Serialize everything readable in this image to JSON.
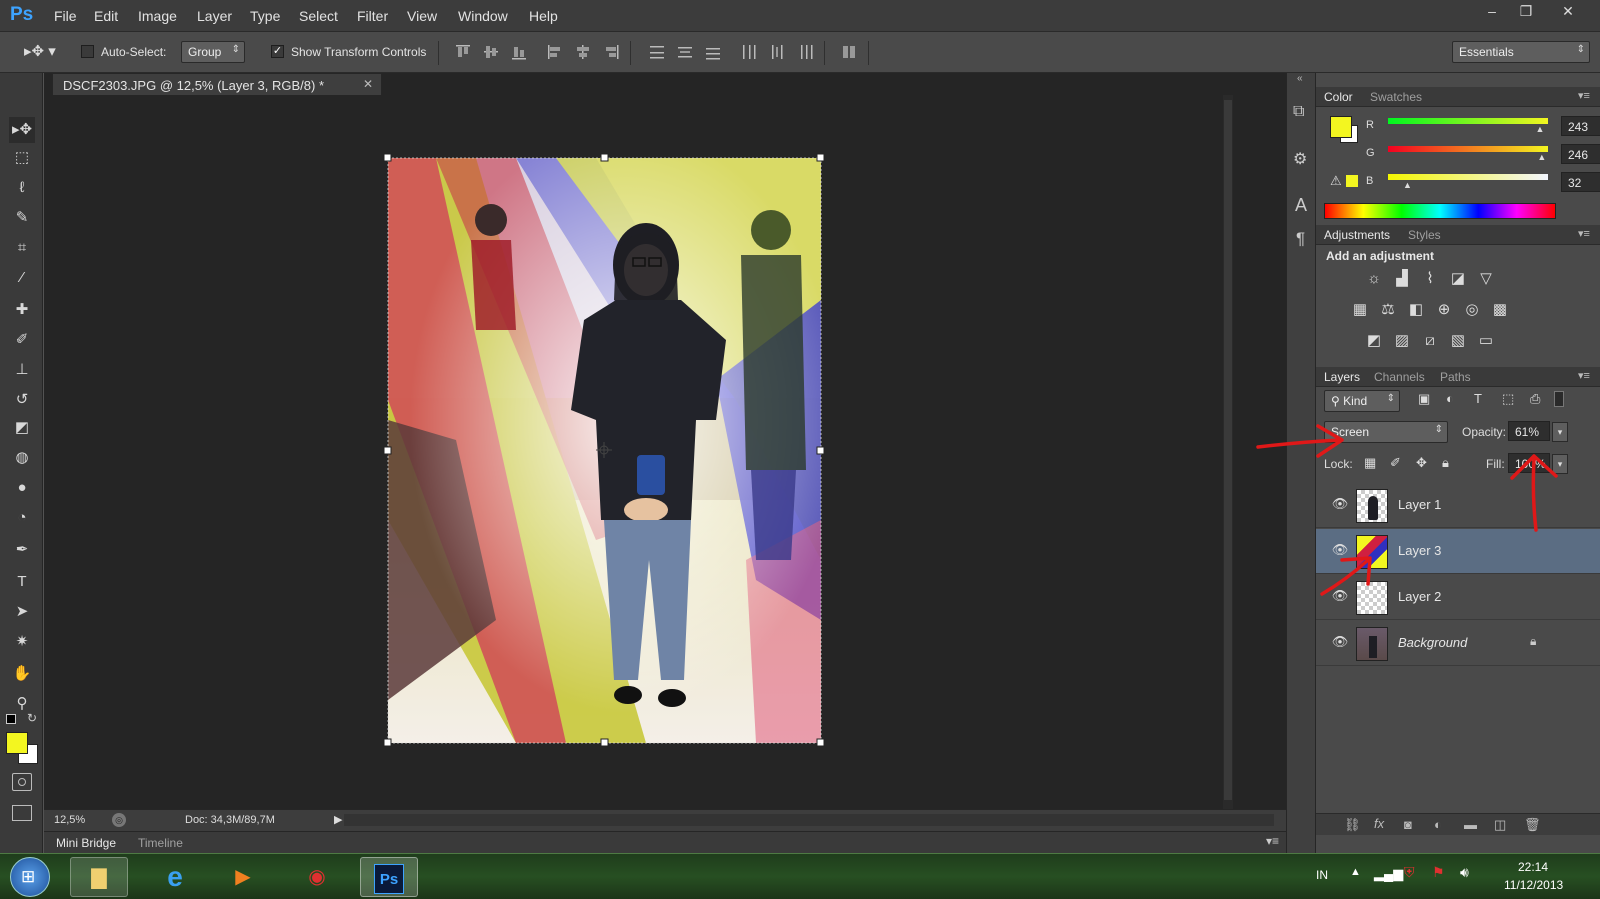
{
  "app": {
    "logo": "Ps"
  },
  "menu": [
    "File",
    "Edit",
    "Image",
    "Layer",
    "Type",
    "Select",
    "Filter",
    "View",
    "Window",
    "Help"
  ],
  "window_controls": {
    "minimize": "–",
    "restore": "❐",
    "close": "✕"
  },
  "options": {
    "auto_select_label": "Auto-Select:",
    "auto_select_checked": false,
    "auto_select_target": "Group",
    "show_transform_label": "Show Transform Controls",
    "show_transform_checked": true,
    "workspace": "Essentials"
  },
  "document": {
    "tab_title": "DSCF2303.JPG @ 12,5% (Layer 3, RGB/8) *",
    "zoom": "12,5%",
    "doc_size": "Doc: 34,3M/89,7M"
  },
  "bottom_tabs": [
    "Mini Bridge",
    "Timeline"
  ],
  "tools": [
    {
      "name": "move-tool-icon",
      "glyph": "▸✥"
    },
    {
      "name": "marquee-tool-icon",
      "glyph": "⬚"
    },
    {
      "name": "lasso-tool-icon",
      "glyph": "ℓ"
    },
    {
      "name": "quick-select-tool-icon",
      "glyph": "✎"
    },
    {
      "name": "crop-tool-icon",
      "glyph": "⌗"
    },
    {
      "name": "eyedropper-tool-icon",
      "glyph": "⁄"
    },
    {
      "name": "healing-brush-tool-icon",
      "glyph": "✚"
    },
    {
      "name": "brush-tool-icon",
      "glyph": "✐"
    },
    {
      "name": "clone-stamp-tool-icon",
      "glyph": "⊥"
    },
    {
      "name": "history-brush-tool-icon",
      "glyph": "↺"
    },
    {
      "name": "eraser-tool-icon",
      "glyph": "◩"
    },
    {
      "name": "paint-bucket-tool-icon",
      "glyph": "◍"
    },
    {
      "name": "blur-tool-icon",
      "glyph": "●"
    },
    {
      "name": "dodge-tool-icon",
      "glyph": "◔"
    },
    {
      "name": "pen-tool-icon",
      "glyph": "✒"
    },
    {
      "name": "type-tool-icon",
      "glyph": "T"
    },
    {
      "name": "path-select-tool-icon",
      "glyph": "➤"
    },
    {
      "name": "shape-tool-icon",
      "glyph": "✷"
    },
    {
      "name": "hand-tool-icon",
      "glyph": "✋"
    },
    {
      "name": "zoom-tool-icon",
      "glyph": "⚲"
    }
  ],
  "colors": {
    "foreground": "#f3f620",
    "background": "#ffffff",
    "accent": "#5b6d83"
  },
  "color_panel": {
    "tabs": [
      "Color",
      "Swatches"
    ],
    "r_label": "R",
    "r_value": "243",
    "g_label": "G",
    "g_value": "246",
    "b_label": "B",
    "b_value": "32",
    "r_fraction": 0.953,
    "g_fraction": 0.965,
    "b_fraction": 0.125
  },
  "adjustments": {
    "tabs": [
      "Adjustments",
      "Styles"
    ],
    "heading": "Add an adjustment",
    "icons": [
      "brightness-icon",
      "levels-icon",
      "curves-icon",
      "exposure-icon",
      "vibrance-icon",
      "hue-saturation-icon",
      "color-balance-icon",
      "black-white-icon",
      "photo-filter-icon",
      "channel-mixer-icon",
      "color-lookup-icon",
      "invert-icon",
      "posterize-icon",
      "threshold-icon",
      "selective-color-icon",
      "gradient-map-icon"
    ]
  },
  "layers_panel": {
    "tabs": [
      "Layers",
      "Channels",
      "Paths"
    ],
    "filter_kind": "Kind",
    "blend_mode": "Screen",
    "opacity_label": "Opacity:",
    "opacity_value": "61%",
    "lock_label": "Lock:",
    "fill_label": "Fill:",
    "fill_value": "100%",
    "layers": [
      {
        "name": "Layer 1",
        "selected": false,
        "visible": true
      },
      {
        "name": "Layer 3",
        "selected": true,
        "visible": true
      },
      {
        "name": "Layer 2",
        "selected": false,
        "visible": true
      },
      {
        "name": "Background",
        "selected": false,
        "visible": true,
        "locked": true
      }
    ]
  },
  "taskbar": {
    "language": "IN",
    "time": "22:14",
    "date": "11/12/2013"
  }
}
